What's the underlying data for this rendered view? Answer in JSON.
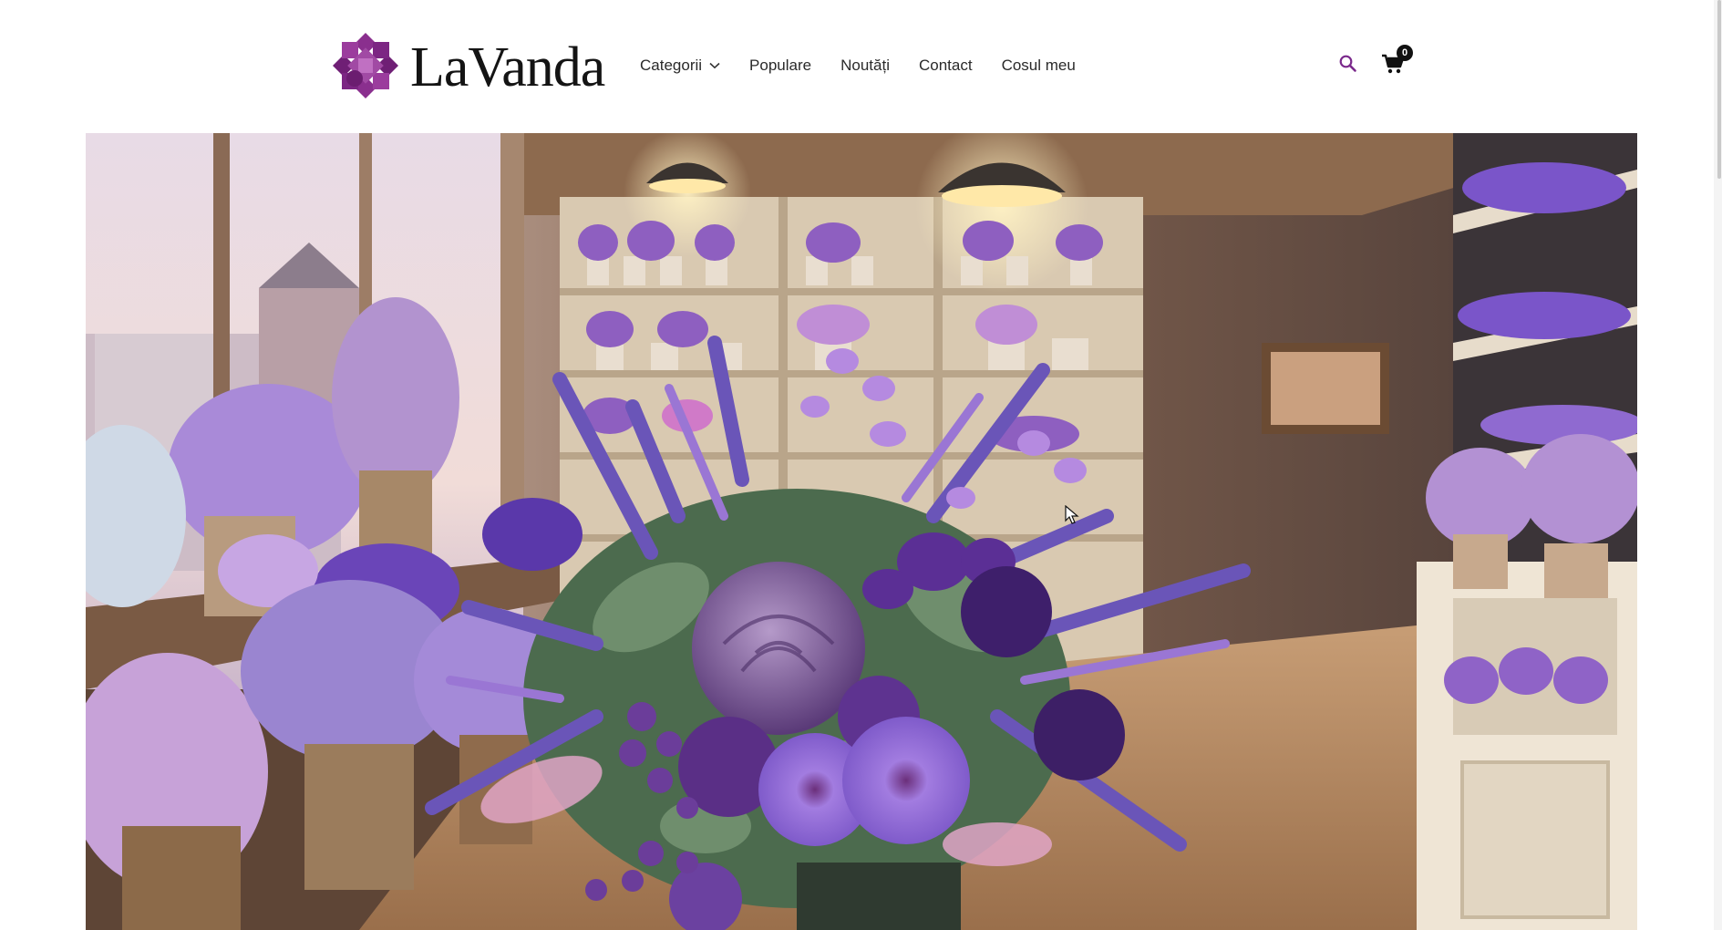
{
  "brand": {
    "logo_text": "LaVanda",
    "logo_icon": "lavender-flower-logo-icon"
  },
  "nav": {
    "items": [
      {
        "label": "Categorii",
        "has_dropdown": true,
        "icon": "chevron-down-icon"
      },
      {
        "label": "Populare"
      },
      {
        "label": "Noutăți"
      },
      {
        "label": "Contact"
      },
      {
        "label": "Cosul meu"
      }
    ]
  },
  "header_actions": {
    "search_icon": "search-icon",
    "cart_icon": "cart-icon",
    "cart_count": "0"
  },
  "hero": {
    "image_subject": "purple bouquet in lavender flower shop"
  },
  "colors": {
    "accent": "#7b2a8c",
    "text": "#2a2a2a",
    "badge_bg": "#111111",
    "header_bg": "#ffffff"
  }
}
